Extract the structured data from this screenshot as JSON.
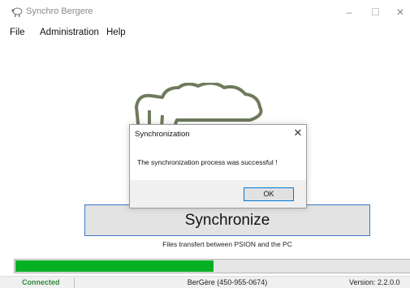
{
  "window": {
    "title": "Synchro Bergere",
    "icon": "sheep-icon",
    "controls": {
      "minimize": "–",
      "close": "✕"
    }
  },
  "menu": {
    "items": [
      "File",
      "Administration",
      "Help"
    ]
  },
  "main": {
    "logo": "sheep-logo",
    "sync_button_label": "Synchronize",
    "caption": "Files transfert between PSION and the PC",
    "progress_fraction": 0.5
  },
  "status": {
    "connection": "Connected",
    "contact": "BerGère (450-955-0674)",
    "version": "Version: 2.2.0.0"
  },
  "dialog": {
    "title": "Synchronization",
    "message": "The synchronization process was successful !",
    "ok_label": "OK",
    "close_glyph": "✕"
  },
  "colors": {
    "progress": "#06b025",
    "connected_text": "#2f8a3c",
    "accent_border": "#3a78c8"
  }
}
